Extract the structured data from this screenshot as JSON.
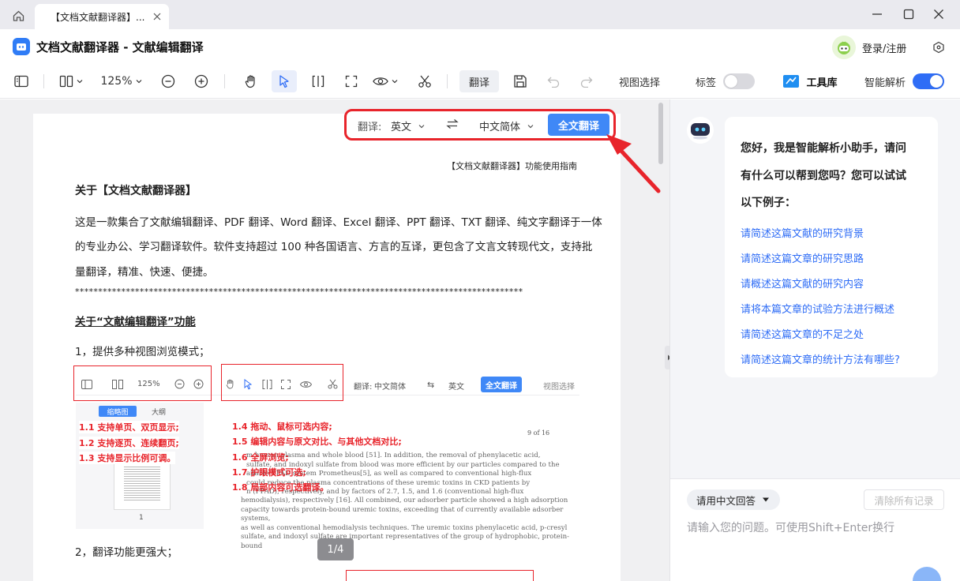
{
  "tab": {
    "title": "【文档文献翻译器】..."
  },
  "app": {
    "title": "文档文献翻译器 - 文献编辑翻译",
    "login": "登录/注册"
  },
  "toolbar": {
    "zoom": "125%",
    "translate": "翻译",
    "view_select": "视图选择",
    "tags_label": "标签",
    "tools_label": "工具库",
    "smart_label": "智能解析"
  },
  "trans_bar": {
    "label": "翻译:",
    "source": "英文",
    "target": "中文简体",
    "full_translate": "全文翻译"
  },
  "doc": {
    "guide": "【文档文献翻译器】功能使用指南",
    "about_title": "关于【文档文献翻译器】",
    "para1_line1": "这是一款集合了文献编辑翻译、PDF 翻译、Word 翻译、Excel 翻译、PPT 翻译、TXT 翻译、纯文字翻译于一体",
    "para1_line2": "的专业办公、学习翻译软件。软件支持超过 100 种各国语言、方言的互译，更包含了文言文转现代文，支持批",
    "para1_line3": "量翻译，精准、快速、便捷。",
    "stars": "*************************************************************************************************",
    "section_title": "关于“文献编辑翻译”功能",
    "item1": "1，提供多种视图浏览模式；",
    "item2": "2，翻译功能更强大；",
    "page_indicator": "1/4"
  },
  "embedded": {
    "zoom": "125%",
    "trans_label": "翻译:",
    "target": "中文简体",
    "source": "英文",
    "full_translate": "全文翻译",
    "view_select": "视图选择",
    "tab_thumb": "缩略图",
    "tab_outline": "大纲",
    "page_num": "1",
    "page_of": "9 of 16",
    "notes_left": [
      "1.1 支持单页、双页显示;",
      "1.2 支持逐页、连续翻页;",
      "1.3 支持显示比例可调。"
    ],
    "notes_right": [
      "1.4 拖动、鼠标可选内容;",
      "1.5 编辑内容与原文对比、与其他文档对比;",
      "1.6 全屏浏览;",
      "1.7 护眼模式可选;",
      "1.8 局部内容可选翻译。"
    ],
    "para_lines": [
      "m human plasma and whole blood [51]. In addition, the removal of phenylacetic acid,",
      "sulfate, and indoxyl sulfate from blood was more efficient by our particles compared to the",
      "ailable FPAD system Prometheus[5], as well as compared to conventional high-flux",
      "could reduce the plasma concentrations of these uremic toxins in CKD patients by",
      "n (FPAD), respectively, and by factors of 2.7, 1.5, and 1.6 (conventional high-flux",
      "hemodialysis), respectively [16]. All combined, our adsorber particle showed a high adsorption",
      "capacity towards protein-bound uremic toxins, exceeding that of currently available adsorber systems,",
      "as well as conventional hemodialysis techniques. The uremic toxins phenylacetic acid, p-cresyl",
      "sulfate, and indoxyl sulfate are important representatives of the group of hydrophobic, protein-bound"
    ]
  },
  "assistant": {
    "greet_line1": "您好，我是智能解析小助手，请问",
    "greet_line2": "有什么可以帮到您吗？您可以试试",
    "greet_line3": "以下例子：",
    "suggestions": [
      "请简述这篇文献的研究背景",
      "请简述这篇文章的研究思路",
      "请概述这篇文献的研究内容",
      "请将本篇文章的试验方法进行概述",
      "请简述这篇文章的不足之处",
      "请简述这篇文章的统计方法有哪些?"
    ],
    "answer_lang": "请用中文回答",
    "clear_history": "清除所有记录",
    "input_placeholder": "请输入您的问题。可使用Shift+Enter换行"
  }
}
